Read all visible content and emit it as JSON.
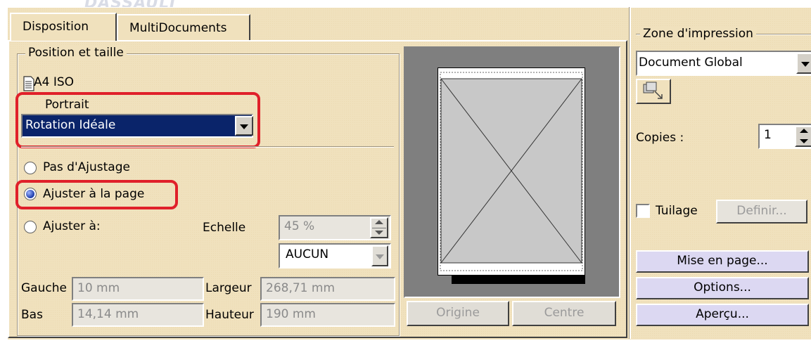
{
  "watermark": "DASSAULT",
  "tabs": [
    {
      "label": "Disposition",
      "active": true
    },
    {
      "label": "MultiDocuments",
      "active": false
    }
  ],
  "position_group": {
    "title": "Position et taille",
    "paper": "A4 ISO",
    "orientation": "Portrait",
    "rotation_select": "Rotation Idéale",
    "options": [
      {
        "label": "Pas d'Ajustage",
        "selected": false
      },
      {
        "label": "Ajuster à la page",
        "selected": true
      },
      {
        "label": "Ajuster à:",
        "selected": false
      }
    ],
    "scale_label": "Echelle",
    "scale_value": "45 %",
    "scale_unit_select": "AUCUN",
    "gauche_label": "Gauche",
    "gauche_value": "10 mm",
    "bas_label": "Bas",
    "bas_value": "14,14 mm",
    "largeur_label": "Largeur",
    "largeur_value": "268,71 mm",
    "hauteur_label": "Hauteur",
    "hauteur_value": "190 mm"
  },
  "preview": {
    "origin_button": "Origine",
    "center_button": "Centre"
  },
  "right_panel": {
    "zone_title": "Zone d'impression",
    "zone_select": "Document Global",
    "copies_label": "Copies :",
    "copies_value": "1",
    "tiling_label": "Tuilage",
    "define_button": "Definir...",
    "page_setup_button": "Mise en page...",
    "options_button": "Options...",
    "preview_button": "Aperçu..."
  },
  "colors": {
    "panel_bg": "#f0e1bd",
    "highlight": "#e0202a",
    "select_bg": "#0a246a",
    "button_purple": "#dcd8f2"
  }
}
